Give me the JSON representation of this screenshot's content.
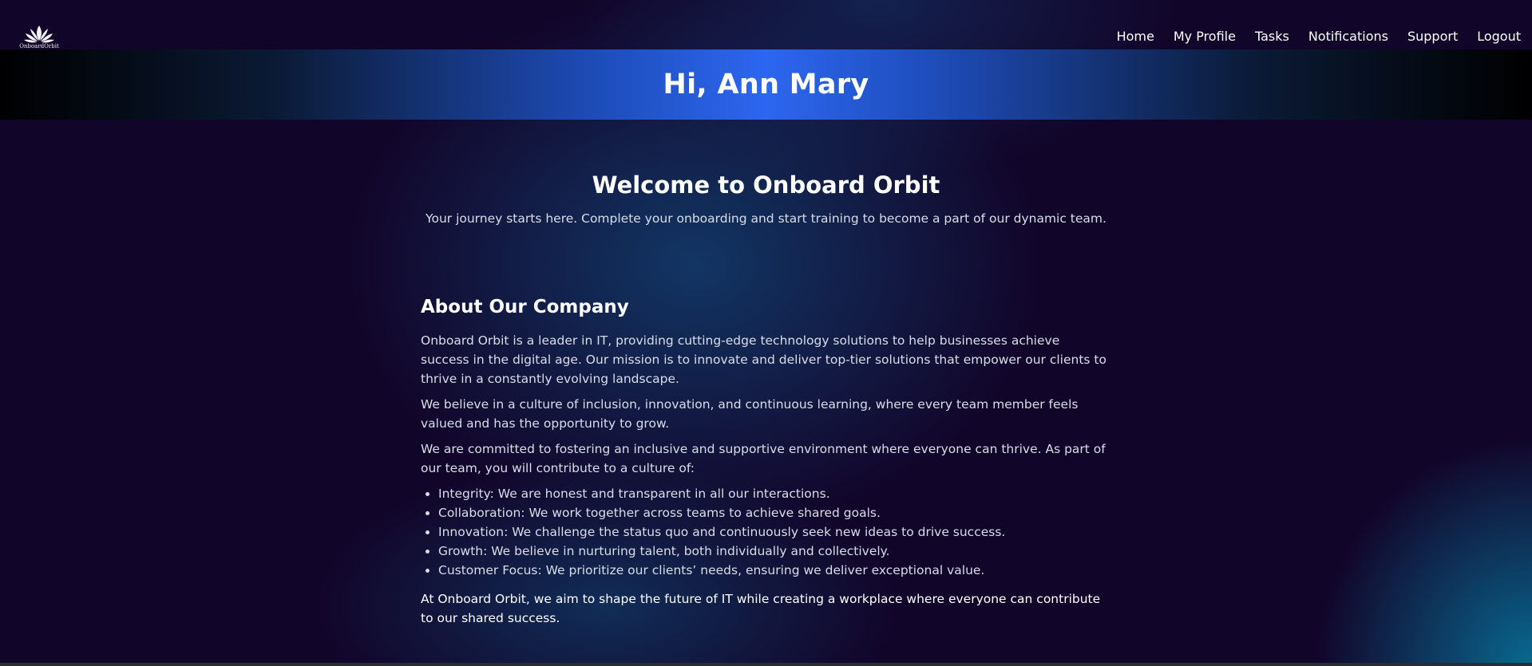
{
  "brand": {
    "logo_text": "OnboardOrbit"
  },
  "nav": {
    "items": [
      {
        "label": "Home"
      },
      {
        "label": "My Profile"
      },
      {
        "label": "Tasks"
      },
      {
        "label": "Notifications"
      },
      {
        "label": "Support"
      },
      {
        "label": "Logout"
      }
    ]
  },
  "banner": {
    "greeting": "Hi, Ann Mary"
  },
  "welcome": {
    "title": "Welcome to Onboard Orbit",
    "subtitle": "Your journey starts here. Complete your onboarding and start training to become a part of our dynamic team."
  },
  "about": {
    "title": "About Our Company",
    "paragraphs": [
      "Onboard Orbit is a leader in IT, providing cutting-edge technology solutions to help businesses achieve success in the digital age. Our mission is to innovate and deliver top-tier solutions that empower our clients to thrive in a constantly evolving landscape.",
      "We believe in a culture of inclusion, innovation, and continuous learning, where every team member feels valued and has the opportunity to grow.",
      "We are committed to fostering an inclusive and supportive environment where everyone can thrive. As part of our team, you will contribute to a culture of:"
    ],
    "values": [
      "Integrity: We are honest and transparent in all our interactions.",
      "Collaboration: We work together across teams to achieve shared goals.",
      "Innovation: We challenge the status quo and continuously seek new ideas to drive success.",
      "Growth: We believe in nurturing talent, both individually and collectively.",
      "Customer Focus: We prioritize our clients’ needs, ensuring we deliver exceptional value."
    ],
    "closing": "At Onboard Orbit, we aim to shape the future of IT while creating a workplace where everyone can contribute to our shared success."
  },
  "colors": {
    "background": "#12052a",
    "banner_center": "#2d66f0",
    "accent_teal": "#086e96"
  }
}
